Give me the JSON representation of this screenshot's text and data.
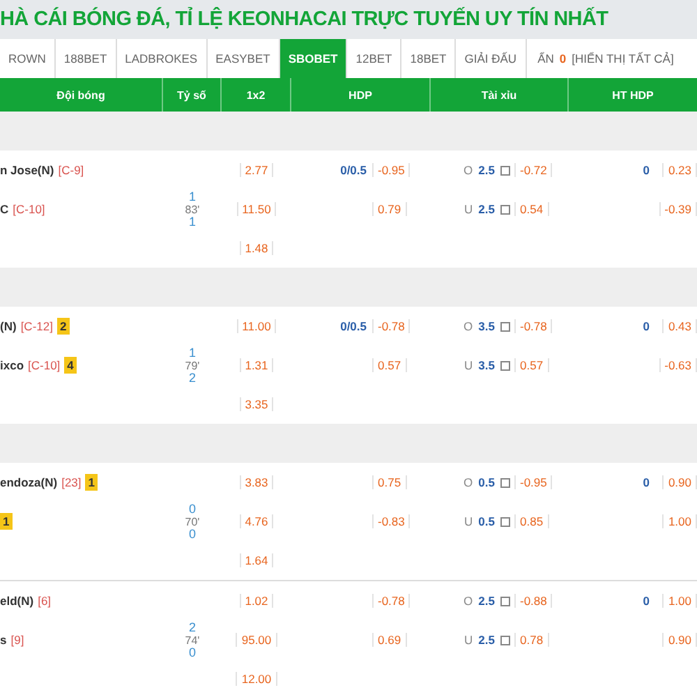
{
  "title": "HÀ CÁI BÓNG ĐÁ, TỈ LỆ KEONHACAI TRỰC TUYẾN UY TÍN NHẤT",
  "tabs": [
    {
      "label": "ROWN",
      "selected": false
    },
    {
      "label": "188BET",
      "selected": false
    },
    {
      "label": "LADBROKES",
      "selected": false
    },
    {
      "label": "EASYBET",
      "selected": false
    },
    {
      "label": "SBOBET",
      "selected": true
    },
    {
      "label": "12BET",
      "selected": false
    },
    {
      "label": "18BET",
      "selected": false
    },
    {
      "label": "GIẢI ĐẤU",
      "selected": false
    }
  ],
  "hidden": {
    "label": "ẨN",
    "count": "0",
    "show_all": "[HIỂN THỊ TẤT CẢ]"
  },
  "columns": [
    "Đội bóng",
    "Tỷ số",
    "1x2",
    "HDP",
    "Tài xỉu",
    "HT HDP"
  ],
  "matches": [
    {
      "league_band": true,
      "home": {
        "name": "n Jose(N)",
        "tag": "[C-9]"
      },
      "away": {
        "name": "C",
        "tag": "[C-10]"
      },
      "score": {
        "home": "1",
        "minute": "83'",
        "away": "1"
      },
      "odds_1x2": [
        "2.77",
        "11.50",
        "1.48"
      ],
      "hdp": {
        "line": "0/0.5",
        "home": "-0.95",
        "away": "0.79"
      },
      "ou": [
        {
          "side": "O",
          "line": "2.5",
          "odds": "-0.72"
        },
        {
          "side": "U",
          "line": "2.5",
          "odds": "0.54"
        }
      ],
      "ht_hdp": {
        "line": "0",
        "home": "0.23",
        "away": "-0.39"
      }
    },
    {
      "league_band": true,
      "home": {
        "name": "(N)",
        "tag": "[C-12]",
        "card": "2"
      },
      "away": {
        "name": "ixco",
        "tag": "[C-10]",
        "card": "4"
      },
      "score": {
        "home": "1",
        "minute": "79'",
        "away": "2"
      },
      "odds_1x2": [
        "11.00",
        "1.31",
        "3.35"
      ],
      "hdp": {
        "line": "0/0.5",
        "home": "-0.78",
        "away": "0.57"
      },
      "ou": [
        {
          "side": "O",
          "line": "3.5",
          "odds": "-0.78"
        },
        {
          "side": "U",
          "line": "3.5",
          "odds": "0.57"
        }
      ],
      "ht_hdp": {
        "line": "0",
        "home": "0.43",
        "away": "-0.63"
      }
    },
    {
      "league_band": true,
      "home": {
        "name": "endoza(N)",
        "tag": "[23]",
        "card": "1"
      },
      "away": {
        "card": "1"
      },
      "score": {
        "home": "0",
        "minute": "70'",
        "away": "0"
      },
      "odds_1x2": [
        "3.83",
        "4.76",
        "1.64"
      ],
      "hdp": {
        "home": "0.75",
        "away": "-0.83"
      },
      "ou": [
        {
          "side": "O",
          "line": "0.5",
          "odds": "-0.95"
        },
        {
          "side": "U",
          "line": "0.5",
          "odds": "0.85"
        }
      ],
      "ht_hdp": {
        "line": "0",
        "home": "0.90",
        "away": "1.00"
      }
    },
    {
      "league_band": false,
      "home": {
        "name": "eld(N)",
        "tag": "[6]"
      },
      "away": {
        "name": "s",
        "tag": "[9]"
      },
      "score": {
        "home": "2",
        "minute": "74'",
        "away": "0"
      },
      "odds_1x2": [
        "1.02",
        "95.00",
        "12.00"
      ],
      "hdp": {
        "home": "-0.78",
        "away": "0.69"
      },
      "ou": [
        {
          "side": "O",
          "line": "2.5",
          "odds": "-0.88"
        },
        {
          "side": "U",
          "line": "2.5",
          "odds": "0.78"
        }
      ],
      "ht_hdp": {
        "line": "0",
        "home": "1.00",
        "away": "0.90"
      }
    }
  ]
}
